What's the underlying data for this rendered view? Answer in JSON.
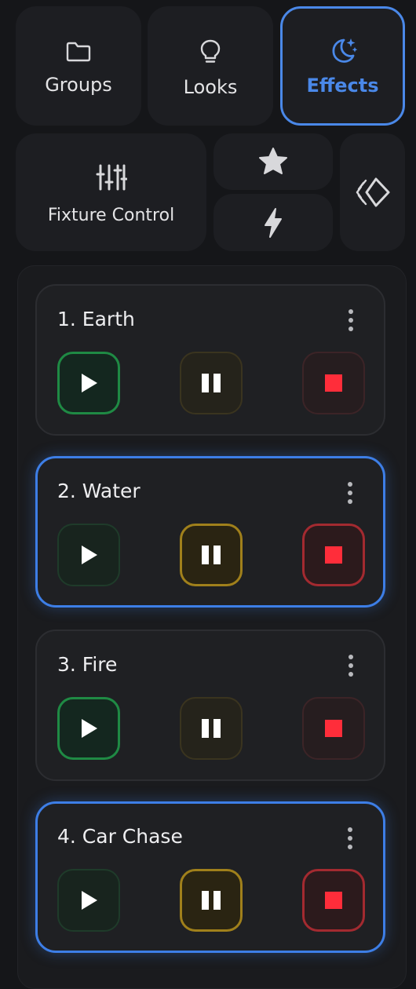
{
  "nav": {
    "groups": {
      "label": "Groups",
      "icon": "folder-icon"
    },
    "looks": {
      "label": "Looks",
      "icon": "lightbulb-icon"
    },
    "effects": {
      "label": "Effects",
      "icon": "moon-stars-icon",
      "active": true
    },
    "fixture_control": {
      "label": "Fixture Control",
      "icon": "sliders-icon"
    },
    "favorites": {
      "icon": "star-icon"
    },
    "flash": {
      "icon": "lightning-icon"
    },
    "brand": {
      "icon": "diamond-logo-icon"
    }
  },
  "effects": [
    {
      "title": "1. Earth",
      "selected": false,
      "state": "playing"
    },
    {
      "title": "2. Water",
      "selected": true,
      "state": "paused-stopped"
    },
    {
      "title": "3. Fire",
      "selected": false,
      "state": "playing"
    },
    {
      "title": "4. Car Chase",
      "selected": true,
      "state": "paused-stopped"
    }
  ],
  "colors": {
    "accent": "#4a88e8",
    "play": "#1f8a44",
    "pause": "#a0801b",
    "stop": "#a32a30",
    "stop_square": "#ff2d3a",
    "background": "#151619",
    "tile": "#1d1e22"
  }
}
